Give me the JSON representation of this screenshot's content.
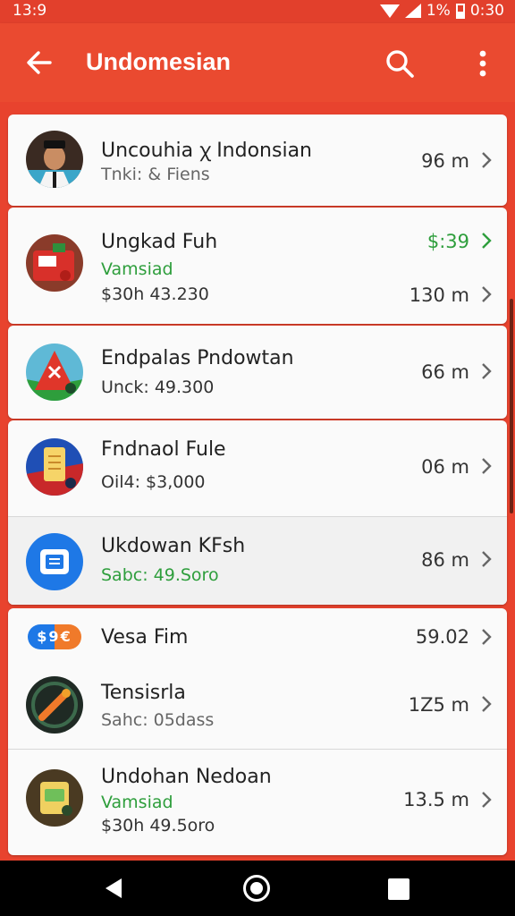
{
  "status_bar": {
    "time": "13:9",
    "battery": "1%",
    "clock": "0:30"
  },
  "app_bar": {
    "title": "Undomesian"
  },
  "items": [
    {
      "title": "Uncouhia ꭓ Indonsian",
      "subtitle": "Tnki: & Fiens",
      "value": "96 m"
    },
    {
      "title": "Ungkad Fuh",
      "subtitle": "Vamsiad",
      "subtitle2": "$30h 43.230",
      "value_top": "$:39",
      "value": "130 m"
    },
    {
      "title": "Endpalas Pndowtan",
      "subtitle": "Unck: 49.300",
      "value": "66 m"
    },
    {
      "title": "Fndnaol Fule",
      "subtitle": "Oil4: $3,000",
      "value": "06 m"
    },
    {
      "title": "Ukdowan KFsh",
      "subtitle": "Sabc: 49.Soro",
      "value": "86 m"
    },
    {
      "pill": "$9€",
      "title": "Vesa Fim",
      "value": "59.02"
    },
    {
      "title": "Tensisrla",
      "subtitle": "Sahc: 05dass",
      "value": "1Z5 m"
    },
    {
      "title": "Undohan Nedoan",
      "subtitle": "Vamsiad",
      "subtitle2": "$30h 49.5oro",
      "value": "13.5 m"
    }
  ],
  "colors": {
    "primary": "#ea4a30",
    "green": "#2e9e3c"
  },
  "icons": [
    "back-arrow-icon",
    "search-icon",
    "more-vert-icon",
    "chevron-right-icon"
  ]
}
